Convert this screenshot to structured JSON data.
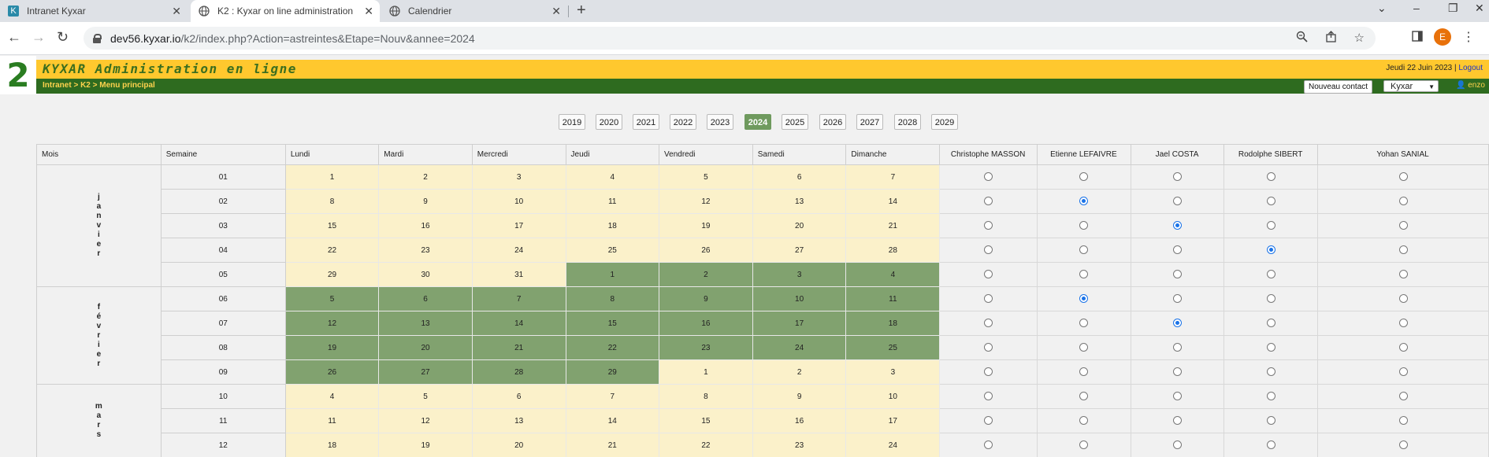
{
  "browser": {
    "tabs": [
      {
        "title": "Intranet Kyxar",
        "favicon": "K"
      },
      {
        "title": "K2 : Kyxar on line administration",
        "favicon": "globe"
      },
      {
        "title": "Calendrier",
        "favicon": "globe"
      }
    ],
    "url_host": "dev56.kyxar.io",
    "url_path": "/k2/index.php?Action=astreintes&Etape=Nouv&annee=2024",
    "profile_initial": "E"
  },
  "header": {
    "logo": "2",
    "title": "KYXAR Administration en ligne",
    "date": "Jeudi 22 Juin 2023 |",
    "logout": "Logout",
    "breadcrumb": "Intranet > K2 > Menu principal",
    "new_contact": "Nouveau contact",
    "company": "Kyxar",
    "user": "enzo"
  },
  "years": [
    "2019",
    "2020",
    "2021",
    "2022",
    "2023",
    "2024",
    "2025",
    "2026",
    "2027",
    "2028",
    "2029"
  ],
  "selected_year": "2024",
  "table": {
    "headers": [
      "Mois",
      "Semaine",
      "Lundi",
      "Mardi",
      "Mercredi",
      "Jeudi",
      "Vendredi",
      "Samedi",
      "Dimanche"
    ],
    "people": [
      "Christophe MASSON",
      "Etienne LEFAIVRE",
      "Jael COSTA",
      "Rodolphe SIBERT",
      "Yohan SANIAL"
    ],
    "months": [
      {
        "name": "janvier",
        "rowspan": 5,
        "letters": [
          "j",
          "a",
          "n",
          "v",
          "i",
          "e",
          "r"
        ]
      },
      {
        "name": "février",
        "rowspan": 4,
        "letters": [
          "f",
          "é",
          "v",
          "r",
          "i",
          "e",
          "r"
        ]
      },
      {
        "name": "mars",
        "rowspan": 3,
        "letters": [
          "m",
          "a",
          "r",
          "s"
        ]
      }
    ],
    "rows": [
      {
        "week": "01",
        "days": [
          "1",
          "2",
          "3",
          "4",
          "5",
          "6",
          "7"
        ],
        "hl": [
          0,
          0,
          0,
          0,
          0,
          0,
          0
        ],
        "sel": -1
      },
      {
        "week": "02",
        "days": [
          "8",
          "9",
          "10",
          "11",
          "12",
          "13",
          "14"
        ],
        "hl": [
          0,
          0,
          0,
          0,
          0,
          0,
          0
        ],
        "sel": 1
      },
      {
        "week": "03",
        "days": [
          "15",
          "16",
          "17",
          "18",
          "19",
          "20",
          "21"
        ],
        "hl": [
          0,
          0,
          0,
          0,
          0,
          0,
          0
        ],
        "sel": 2
      },
      {
        "week": "04",
        "days": [
          "22",
          "23",
          "24",
          "25",
          "26",
          "27",
          "28"
        ],
        "hl": [
          0,
          0,
          0,
          0,
          0,
          0,
          0
        ],
        "sel": 3
      },
      {
        "week": "05",
        "days": [
          "29",
          "30",
          "31",
          "1",
          "2",
          "3",
          "4"
        ],
        "hl": [
          0,
          0,
          0,
          1,
          1,
          1,
          1
        ],
        "sel": -1
      },
      {
        "week": "06",
        "days": [
          "5",
          "6",
          "7",
          "8",
          "9",
          "10",
          "11"
        ],
        "hl": [
          1,
          1,
          1,
          1,
          1,
          1,
          1
        ],
        "sel": 1
      },
      {
        "week": "07",
        "days": [
          "12",
          "13",
          "14",
          "15",
          "16",
          "17",
          "18"
        ],
        "hl": [
          1,
          1,
          1,
          1,
          1,
          1,
          1
        ],
        "sel": 2
      },
      {
        "week": "08",
        "days": [
          "19",
          "20",
          "21",
          "22",
          "23",
          "24",
          "25"
        ],
        "hl": [
          1,
          1,
          1,
          1,
          1,
          1,
          1
        ],
        "sel": -1
      },
      {
        "week": "09",
        "days": [
          "26",
          "27",
          "28",
          "29",
          "1",
          "2",
          "3"
        ],
        "hl": [
          1,
          1,
          1,
          1,
          0,
          0,
          0
        ],
        "sel": -1
      },
      {
        "week": "10",
        "days": [
          "4",
          "5",
          "6",
          "7",
          "8",
          "9",
          "10"
        ],
        "hl": [
          0,
          0,
          0,
          0,
          0,
          0,
          0
        ],
        "sel": -1
      },
      {
        "week": "11",
        "days": [
          "11",
          "12",
          "13",
          "14",
          "15",
          "16",
          "17"
        ],
        "hl": [
          0,
          0,
          0,
          0,
          0,
          0,
          0
        ],
        "sel": -1
      },
      {
        "week": "12",
        "days": [
          "18",
          "19",
          "20",
          "21",
          "22",
          "23",
          "24"
        ],
        "hl": [
          0,
          0,
          0,
          0,
          0,
          0,
          0
        ],
        "sel": -1
      }
    ]
  }
}
